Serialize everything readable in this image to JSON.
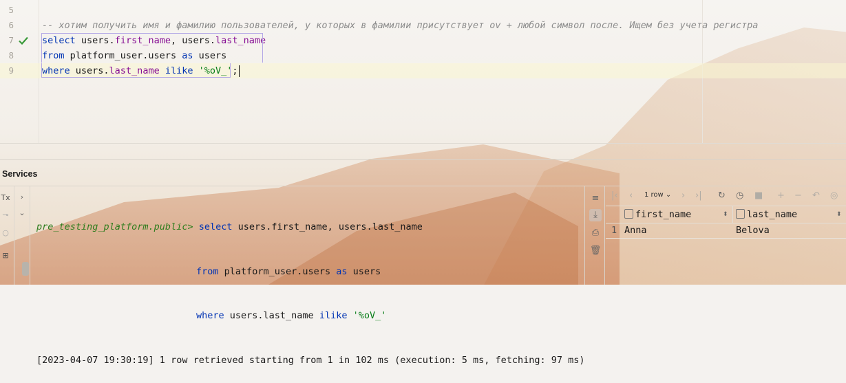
{
  "editor": {
    "lines": [
      {
        "num": "5"
      },
      {
        "num": "6",
        "comment": "-- хотим получить имя и фамилию пользователей, у которых в фамилии присутствует ov + любой символ после. Ищем без учета регистра"
      },
      {
        "num": "7",
        "status": "check-icon"
      },
      {
        "num": "8"
      },
      {
        "num": "9"
      }
    ],
    "sql": {
      "select_kw": "select",
      "users1": "users.",
      "first_name": "first_name",
      "comma": ", users.",
      "last_name": "last_name",
      "from_kw": "from",
      "table": " platform_user.users ",
      "as_kw": "as",
      "alias": " users",
      "where_kw": "where",
      "where_users": " users.",
      "where_field": "last_name",
      "ilike_kw": "ilike",
      "pattern": "'%oV_'",
      "semicolon": ";"
    }
  },
  "services": {
    "title": "Services",
    "left_tools": [
      "Tx",
      "⊸",
      "○",
      "⊞"
    ],
    "console": {
      "prompt": "pre_testing_platform.public>",
      "q1_kw": "select",
      "q1_rest": " users.first_name, users.last_name",
      "q2_kw": "from",
      "q2_rest": " platform_user.users ",
      "q2_as": "as",
      "q2_alias": " users",
      "q3_kw": "where",
      "q3_rest": " users.last_name ",
      "q3_ilike": "ilike",
      "q3_pattern": " '%oV_'",
      "log": "[2023-04-07 19:30:19] 1 row retrieved starting from 1 in 102 ms (execution: 5 ms, fetching: 97 ms)"
    }
  },
  "results": {
    "page_size": "1 row",
    "columns": [
      {
        "name": "first_name"
      },
      {
        "name": "last_name"
      }
    ],
    "rows": [
      {
        "index": "1",
        "first_name": "Anna",
        "last_name": "Belova"
      }
    ]
  }
}
